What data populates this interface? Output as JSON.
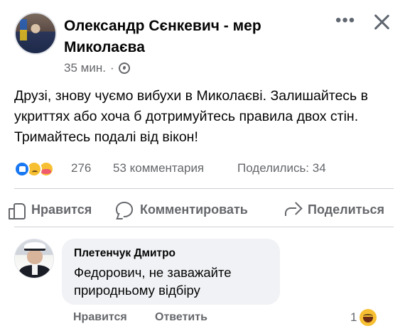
{
  "post": {
    "author": "Олександр Сєнкевич - мер Миколаєва",
    "time": "35 мин.",
    "separator": "·",
    "body": "Друзі, знову чуємо вибухи в Миколаєві. Залишайтесь в укриттях або хоча б дотримуйтесь правила двох стін. Тримайтесь подалі від вікон!",
    "more_label": "•••",
    "visibility_icon": "globe-icon",
    "close_icon": "close-icon"
  },
  "stats": {
    "reactions": "276",
    "reaction_icons": [
      "like-icon",
      "sad-icon",
      "care-icon"
    ],
    "comments": "53 комментария",
    "shares": "Поделились: 34"
  },
  "actions": {
    "like": "Нравится",
    "comment": "Комментировать",
    "share": "Поделиться"
  },
  "comment": {
    "author": "Плетенчук Дмитро",
    "text": "Федорович, не заважайте природньому відбіру",
    "like": "Нравится",
    "reply": "Ответить",
    "reaction_count": "1",
    "reaction_icon": "haha-icon"
  },
  "colors": {
    "text": "#050505",
    "secondary": "#65676b",
    "bubble": "#f0f2f5",
    "accent": "#1877f2"
  }
}
